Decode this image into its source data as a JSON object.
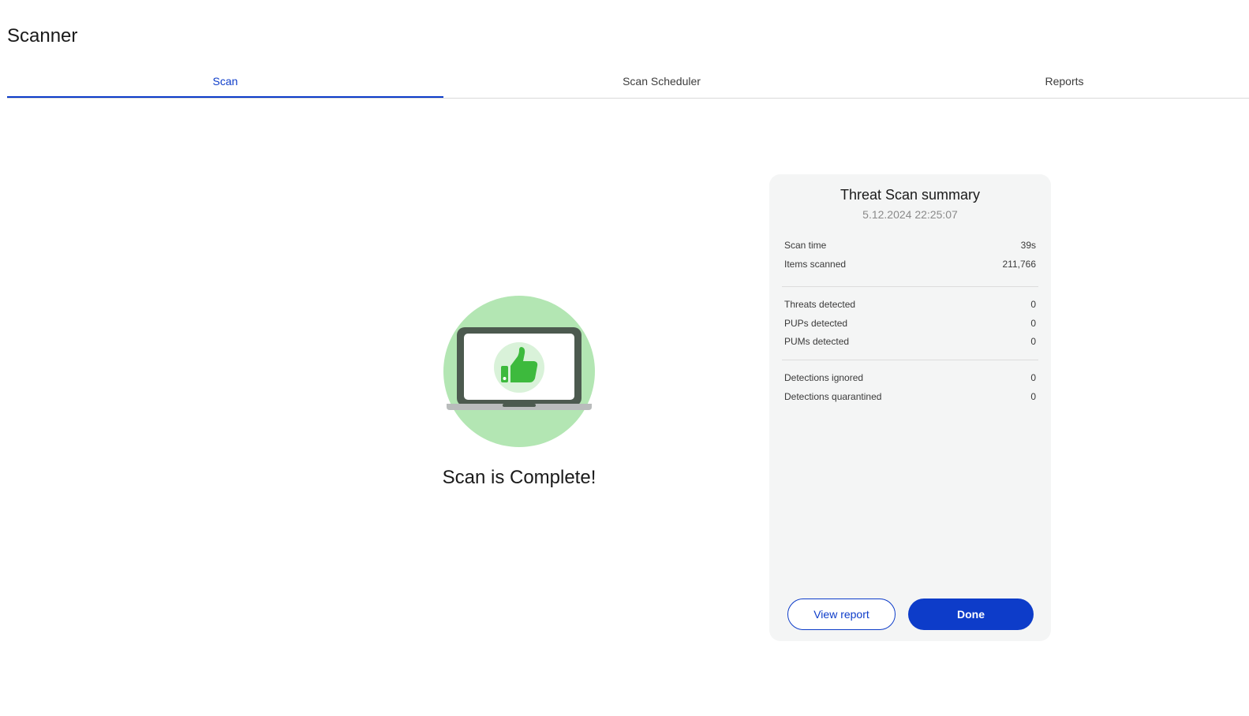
{
  "page": {
    "title": "Scanner"
  },
  "tabs": [
    {
      "label": "Scan",
      "active": true
    },
    {
      "label": "Scan Scheduler",
      "active": false
    },
    {
      "label": "Reports",
      "active": false
    }
  ],
  "status": {
    "message": "Scan is Complete!",
    "illustration_icon": "laptop-thumbs-up-icon"
  },
  "summary": {
    "title": "Threat Scan summary",
    "date": "5.12.2024 22:25:07",
    "groups": [
      [
        {
          "label": "Scan time",
          "value": "39s"
        },
        {
          "label": "Items scanned",
          "value": "211,766"
        }
      ],
      [
        {
          "label": "Threats detected",
          "value": "0"
        },
        {
          "label": "PUPs detected",
          "value": "0"
        },
        {
          "label": "PUMs detected",
          "value": "0"
        }
      ],
      [
        {
          "label": "Detections ignored",
          "value": "0"
        },
        {
          "label": "Detections quarantined",
          "value": "0"
        }
      ]
    ],
    "view_report_label": "View report",
    "done_label": "Done"
  },
  "colors": {
    "accent": "#0d3cc9",
    "success_green": "#3dba3d",
    "circle_bg": "#b3e6b3",
    "card_bg": "#f4f5f5"
  }
}
